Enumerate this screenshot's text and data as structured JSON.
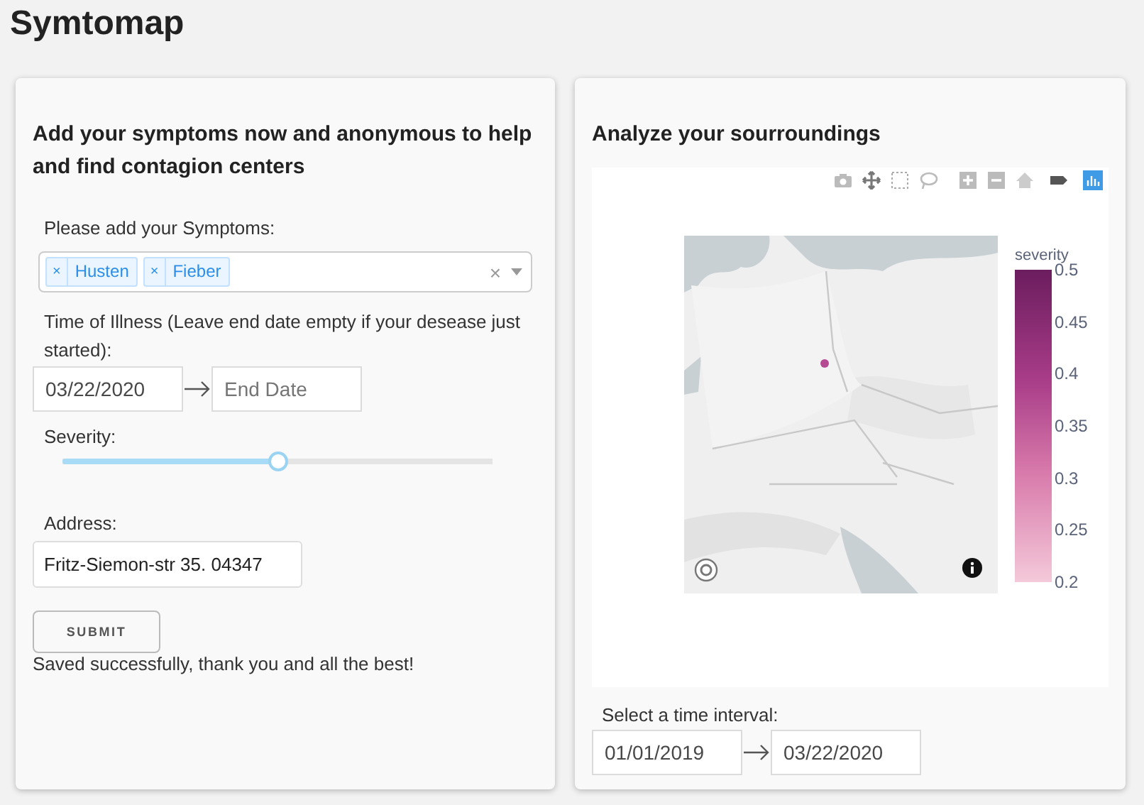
{
  "app": {
    "title": "Symtomap"
  },
  "report_form": {
    "heading": "Add your symptoms now and anonymous to help and find contagion centers",
    "symptoms": {
      "label": "Please add your Symptoms:",
      "tags": [
        {
          "remove": "×",
          "label": "Husten"
        },
        {
          "remove": "×",
          "label": "Fieber"
        }
      ],
      "clear": "×"
    },
    "illness_time": {
      "label": "Time of Illness (Leave end date empty if your desease just started):",
      "start": {
        "value": "03/22/2020"
      },
      "end": {
        "placeholder": "End Date"
      }
    },
    "severity": {
      "label": "Severity:",
      "level": 0.5
    },
    "address": {
      "label": "Address:",
      "value": "Fritz-Siemon-str 35. 04347"
    },
    "submit": "SUBMIT",
    "message": "Saved successfully, thank you and all the best!"
  },
  "analysis": {
    "heading": "Analyze your sourroundings",
    "colorbar": {
      "title": "severity",
      "ticks": [
        "0.5",
        "0.45",
        "0.4",
        "0.35",
        "0.3",
        "0.25",
        "0.2"
      ]
    },
    "time_interval": {
      "label": "Select a time interval:",
      "start": {
        "value": "01/01/2019"
      },
      "end": {
        "value": "03/22/2020"
      }
    }
  }
}
